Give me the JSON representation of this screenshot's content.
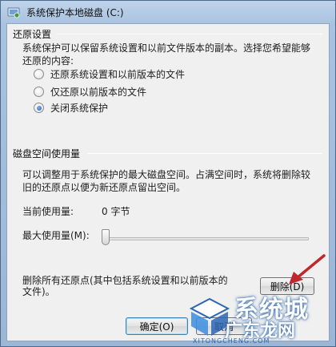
{
  "window": {
    "title": "系统保护本地磁盘 (C:)"
  },
  "restore": {
    "group_label": "还原设置",
    "description": [
      "系统保护可以保留系统设置和以前文件版本的副本。选择您希望能够",
      "还原的内容:"
    ],
    "options": [
      {
        "label": "还原系统设置和以前版本的文件",
        "checked": false
      },
      {
        "label": "仅还原以前版本的文件",
        "checked": false
      },
      {
        "label": "关闭系统保护",
        "checked": true
      }
    ]
  },
  "disk": {
    "group_label": "磁盘空间使用量",
    "description": [
      "可以调整用于系统保护的最大磁盘空间。占满空间时，系统将删除较",
      "旧的还原点以便为新还原点留出空间。"
    ],
    "current_label": "当前使用量:",
    "current_value": "0 字节",
    "max_label": "最大使用量(M):",
    "max_fraction": 0
  },
  "delete": {
    "description": [
      "删除所有还原点(其中包括系统设置和以前版本的",
      "文件)。"
    ],
    "button_label": "删除(D)"
  },
  "footer": {
    "ok_label": "确定(O)",
    "cancel_label": "取消"
  },
  "watermark": {
    "main": "系统城",
    "sub": "广东龙网",
    "url": "XITONGCHENG.COM"
  },
  "colors": {
    "accent": "#3c7fb1",
    "arrow": "#c0282d"
  }
}
